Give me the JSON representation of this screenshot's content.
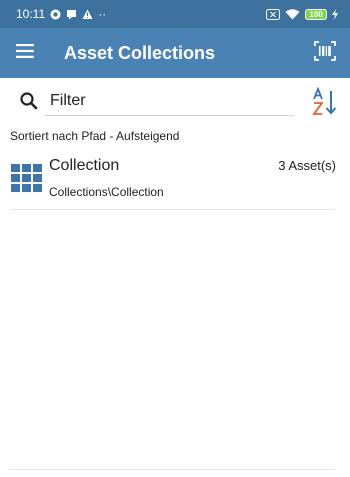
{
  "status_bar": {
    "time": "10:11",
    "dots": "··",
    "battery": "100"
  },
  "app_bar": {
    "title": "Asset Collections",
    "menu_icon": "menu-icon",
    "barcode_icon": "barcode-scan-icon"
  },
  "filter": {
    "placeholder": "Filter",
    "value": "",
    "search_icon": "search-icon",
    "sort_icon": "sort-az-icon"
  },
  "sort_status": "Sortiert nach Pfad - Aufsteigend",
  "collections": [
    {
      "name": "Collection",
      "path": "Collections\\Collection",
      "count": "3 Asset(s)",
      "icon": "grid-icon"
    }
  ],
  "colors": {
    "status_bar": "#3d729f",
    "app_bar": "#4a82b3",
    "grid_icon": "#3f74a8",
    "sort_red": "#e06030",
    "sort_blue": "#3a74b0"
  }
}
